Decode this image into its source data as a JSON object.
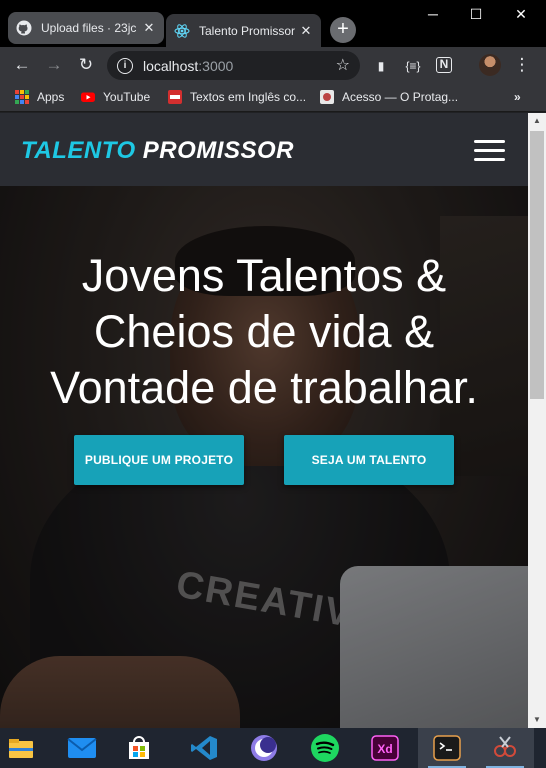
{
  "browser": {
    "tabs": [
      {
        "title": "Upload files · 23jc",
        "icon": "github-icon",
        "active": false
      },
      {
        "title": "Talento Promissor",
        "icon": "react-icon",
        "active": true
      }
    ],
    "new_tab_label": "+",
    "address": {
      "host": "localhost",
      "port": ":3000"
    },
    "bookmarks": [
      {
        "label": "Apps",
        "icon": "apps-grid-icon"
      },
      {
        "label": "YouTube",
        "icon": "youtube-icon"
      },
      {
        "label": "Textos em Inglês co...",
        "icon": "bookmark-favicon-icon"
      },
      {
        "label": "Acesso — O Protag...",
        "icon": "bookmark-favicon-icon"
      }
    ],
    "more_bookmarks": "»"
  },
  "site": {
    "brand_part1": "TALENTO",
    "brand_part2": "PROMISSOR",
    "brand_color": "#1ec8e4",
    "headline_lines": [
      "Jovens Talentos &",
      "Cheios de vida &",
      "Vontade de trabalhar."
    ],
    "buttons": {
      "primary": "PUBLIQUE UM PROJETO",
      "secondary": "SEJA UM TALENTO"
    },
    "button_color": "#17a2b8",
    "shirt_text": "CREATIVE"
  },
  "taskbar": {
    "apps": [
      "file-explorer-icon",
      "mail-icon",
      "store-icon",
      "vscode-icon",
      "browser-moon-icon",
      "spotify-icon",
      "adobe-xd-icon",
      "terminal-icon",
      "snipping-tool-icon"
    ]
  }
}
